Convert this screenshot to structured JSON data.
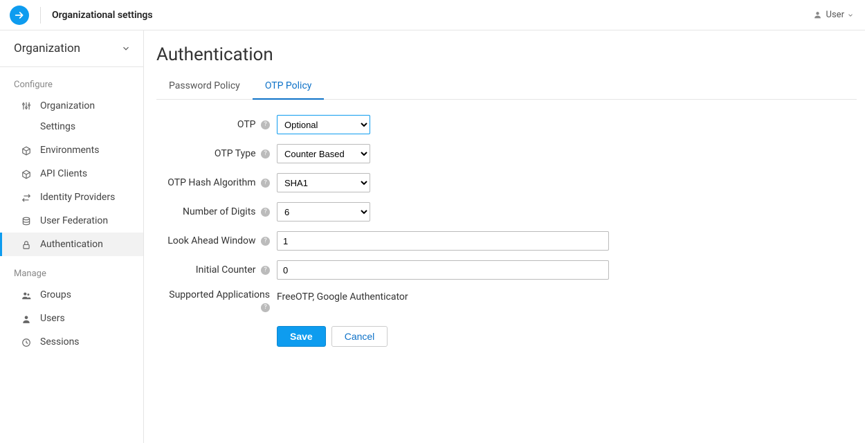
{
  "header": {
    "title": "Organizational settings",
    "user_label": "User"
  },
  "sidebar": {
    "org_label": "Organization",
    "sections": {
      "configure": "Configure",
      "manage": "Manage"
    },
    "items": {
      "org_settings_line1": "Organization",
      "org_settings_line2": "Settings",
      "environments": "Environments",
      "api_clients": "API Clients",
      "identity_providers": "Identity Providers",
      "user_federation": "User Federation",
      "authentication": "Authentication",
      "groups": "Groups",
      "users": "Users",
      "sessions": "Sessions"
    }
  },
  "page": {
    "title": "Authentication",
    "tabs": {
      "password_policy": "Password Policy",
      "otp_policy": "OTP Policy"
    }
  },
  "form": {
    "labels": {
      "otp": "OTP",
      "otp_type": "OTP Type",
      "otp_hash": "OTP Hash Algorithm",
      "digits": "Number of Digits",
      "look_ahead": "Look Ahead Window",
      "initial_counter": "Initial Counter",
      "supported_apps": "Supported Applications"
    },
    "values": {
      "otp": "Optional",
      "otp_type": "Counter Based",
      "otp_hash": "SHA1",
      "digits": "6",
      "look_ahead": "1",
      "initial_counter": "0",
      "supported_apps": "FreeOTP, Google Authenticator"
    },
    "buttons": {
      "save": "Save",
      "cancel": "Cancel"
    }
  }
}
